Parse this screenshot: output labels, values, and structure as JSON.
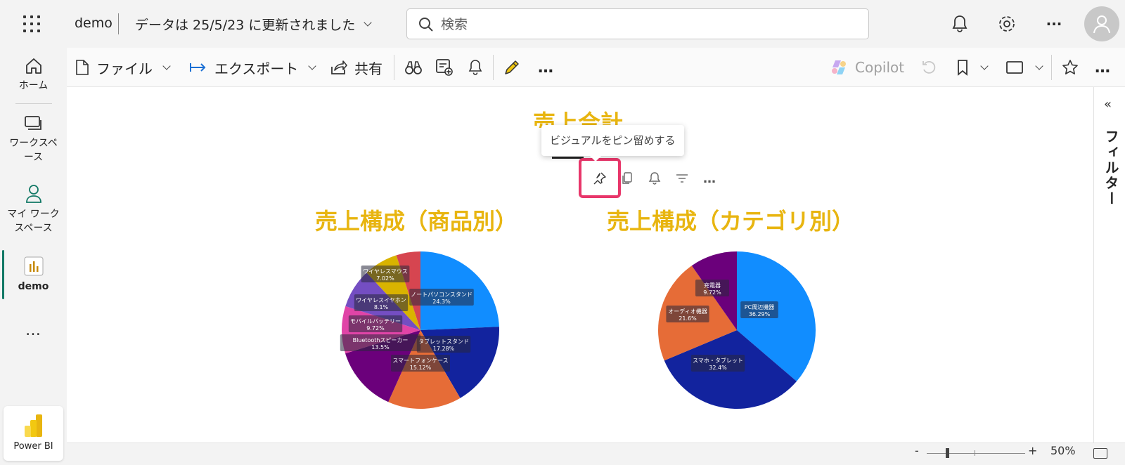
{
  "header": {
    "app_name": "demo",
    "updated_text": "データは 25/5/23 に更新されました",
    "search_placeholder": "検索"
  },
  "leftnav": {
    "items": [
      {
        "label": "ホーム"
      },
      {
        "label": "ワークスペース"
      },
      {
        "label": "マイ ワークスペース"
      },
      {
        "label": "demo"
      }
    ],
    "more": "…",
    "product": "Power BI"
  },
  "toolbar": {
    "file": "ファイル",
    "export": "エクスポート",
    "share": "共有",
    "copilot": "Copilot",
    "more": "…"
  },
  "report": {
    "title_total": "売上合計",
    "tooltip": "ビジュアルをピン留めする",
    "filter_label": "フィルター"
  },
  "status": {
    "zoom_minus": "-",
    "zoom_plus": "+",
    "zoom_level": "50%"
  },
  "colors": {
    "accent_title": "#e8b510",
    "highlight": "#e8366a"
  },
  "chart_data": [
    {
      "type": "pie",
      "title": "売上構成（商品別）",
      "slices": [
        {
          "label": "ノートパソコンスタンド",
          "value": 24.3,
          "pct": "24.3%",
          "color": "#118dff"
        },
        {
          "label": "タブレットスタンド",
          "value": 17.28,
          "pct": "17.28%",
          "color": "#12239e"
        },
        {
          "label": "スマートフォンケース",
          "value": 15.12,
          "pct": "15.12%",
          "color": "#e66c37"
        },
        {
          "label": "Bluetoothスピーカー",
          "value": 13.5,
          "pct": "13.5%",
          "color": "#6b007b"
        },
        {
          "label": "モバイルバッテリー",
          "value": 9.72,
          "pct": "9.72%",
          "color": "#e044a7"
        },
        {
          "label": "ワイヤレスイヤホン",
          "value": 8.1,
          "pct": "8.1%",
          "color": "#744ec2"
        },
        {
          "label": "ワイヤレスマウス",
          "value": 7.02,
          "pct": "7.02%",
          "color": "#d9b300"
        },
        {
          "label": "",
          "value": 4.96,
          "pct": "",
          "color": "#d64550"
        }
      ]
    },
    {
      "type": "pie",
      "title": "売上構成（カテゴリ別）",
      "slices": [
        {
          "label": "PC周辺機器",
          "value": 36.29,
          "pct": "36.29%",
          "color": "#118dff"
        },
        {
          "label": "スマホ・タブレット",
          "value": 32.4,
          "pct": "32.4%",
          "color": "#12239e"
        },
        {
          "label": "オーディオ機器",
          "value": 21.6,
          "pct": "21.6%",
          "color": "#e66c37"
        },
        {
          "label": "充電器",
          "value": 9.72,
          "pct": "9.72%",
          "color": "#6b007b"
        }
      ]
    }
  ]
}
